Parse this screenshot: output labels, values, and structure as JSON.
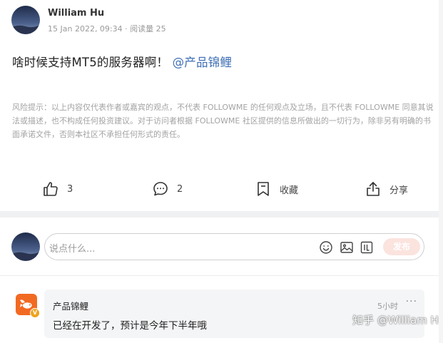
{
  "post": {
    "author": "William Hu",
    "meta": "15 Jan 2022, 09:34 · 阅读量 25",
    "body_text": "啥时候支持MT5的服务器啊！",
    "mention": "@产品锦鲤",
    "disclaimer": "风险提示：以上内容仅代表作者或嘉宾的观点，不代表 FOLLOWME 的任何观点及立场，且不代表 FOLLOWME 同意其说法或描述，也不构成任何投资建议。对于访问者根据 FOLLOWME 社区提供的信息所做出的一切行为，除非另有明确的书面承诺文件，否则本社区不承担任何形式的责任。"
  },
  "actions": {
    "like_count": "3",
    "comment_count": "2",
    "favorite_label": "收藏",
    "share_label": "分享"
  },
  "composer": {
    "placeholder": "说点什么...",
    "post_button": "发布"
  },
  "reply": {
    "author": "产品锦鲤",
    "badge": "V",
    "time": "5小时",
    "more": "···",
    "text": "已经在开发了，预计是今年下半年哦"
  },
  "watermark": "知乎 @William Hu",
  "icons": {
    "like": "thumbs-up-icon",
    "comment": "speech-bubble-icon",
    "favorite": "bookmark-icon",
    "share": "share-icon",
    "emoji": "emoji-icon",
    "image": "image-icon",
    "gif": "gif-icon"
  },
  "colors": {
    "mention": "#3f6fb4",
    "post_button_bg": "#fbe3de",
    "brand_orange": "#f26a22"
  }
}
